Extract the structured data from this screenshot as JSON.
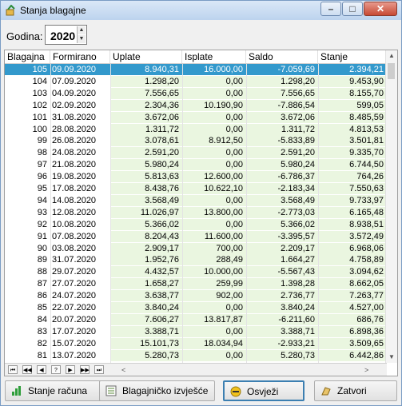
{
  "window": {
    "title": "Stanja blagajne"
  },
  "toolbar": {
    "year_label": "Godina:",
    "year_value": "2020"
  },
  "columns": [
    "Blagajna",
    "Formirano",
    "Uplate",
    "Isplate",
    "Saldo",
    "Stanje"
  ],
  "rows": [
    [
      "105",
      "09.09.2020",
      "8.940,31",
      "16.000,00",
      "-7.059,69",
      "2.394,21"
    ],
    [
      "104",
      "07.09.2020",
      "1.298,20",
      "0,00",
      "1.298,20",
      "9.453,90"
    ],
    [
      "103",
      "04.09.2020",
      "7.556,65",
      "0,00",
      "7.556,65",
      "8.155,70"
    ],
    [
      "102",
      "02.09.2020",
      "2.304,36",
      "10.190,90",
      "-7.886,54",
      "599,05"
    ],
    [
      "101",
      "31.08.2020",
      "3.672,06",
      "0,00",
      "3.672,06",
      "8.485,59"
    ],
    [
      "100",
      "28.08.2020",
      "1.311,72",
      "0,00",
      "1.311,72",
      "4.813,53"
    ],
    [
      "99",
      "26.08.2020",
      "3.078,61",
      "8.912,50",
      "-5.833,89",
      "3.501,81"
    ],
    [
      "98",
      "24.08.2020",
      "2.591,20",
      "0,00",
      "2.591,20",
      "9.335,70"
    ],
    [
      "97",
      "21.08.2020",
      "5.980,24",
      "0,00",
      "5.980,24",
      "6.744,50"
    ],
    [
      "96",
      "19.08.2020",
      "5.813,63",
      "12.600,00",
      "-6.786,37",
      "764,26"
    ],
    [
      "95",
      "17.08.2020",
      "8.438,76",
      "10.622,10",
      "-2.183,34",
      "7.550,63"
    ],
    [
      "94",
      "14.08.2020",
      "3.568,49",
      "0,00",
      "3.568,49",
      "9.733,97"
    ],
    [
      "93",
      "12.08.2020",
      "11.026,97",
      "13.800,00",
      "-2.773,03",
      "6.165,48"
    ],
    [
      "92",
      "10.08.2020",
      "5.366,02",
      "0,00",
      "5.366,02",
      "8.938,51"
    ],
    [
      "91",
      "07.08.2020",
      "8.204,43",
      "11.600,00",
      "-3.395,57",
      "3.572,49"
    ],
    [
      "90",
      "03.08.2020",
      "2.909,17",
      "700,00",
      "2.209,17",
      "6.968,06"
    ],
    [
      "89",
      "31.07.2020",
      "1.952,76",
      "288,49",
      "1.664,27",
      "4.758,89"
    ],
    [
      "88",
      "29.07.2020",
      "4.432,57",
      "10.000,00",
      "-5.567,43",
      "3.094,62"
    ],
    [
      "87",
      "27.07.2020",
      "1.658,27",
      "259,99",
      "1.398,28",
      "8.662,05"
    ],
    [
      "86",
      "24.07.2020",
      "3.638,77",
      "902,00",
      "2.736,77",
      "7.263,77"
    ],
    [
      "85",
      "22.07.2020",
      "3.840,24",
      "0,00",
      "3.840,24",
      "4.527,00"
    ],
    [
      "84",
      "20.07.2020",
      "7.606,27",
      "13.817,87",
      "-6.211,60",
      "686,76"
    ],
    [
      "83",
      "17.07.2020",
      "3.388,71",
      "0,00",
      "3.388,71",
      "6.898,36"
    ],
    [
      "82",
      "15.07.2020",
      "15.101,73",
      "18.034,94",
      "-2.933,21",
      "3.509,65"
    ],
    [
      "81",
      "13.07.2020",
      "5.280,73",
      "0,00",
      "5.280,73",
      "6.442,86"
    ]
  ],
  "selected_row": 0,
  "nav_buttons": [
    "⏮",
    "◀◀",
    "◀",
    "?",
    "▶",
    "▶▶",
    "⏭"
  ],
  "buttons": {
    "account_state": "Stanje računa",
    "cash_report": "Blagajničko izvješće",
    "refresh": "Osvježi",
    "close": "Zatvori"
  },
  "colors": {
    "selection": "#3399cc",
    "green_column": "#eaf6e0",
    "titlebar": "#bcd3ee"
  }
}
